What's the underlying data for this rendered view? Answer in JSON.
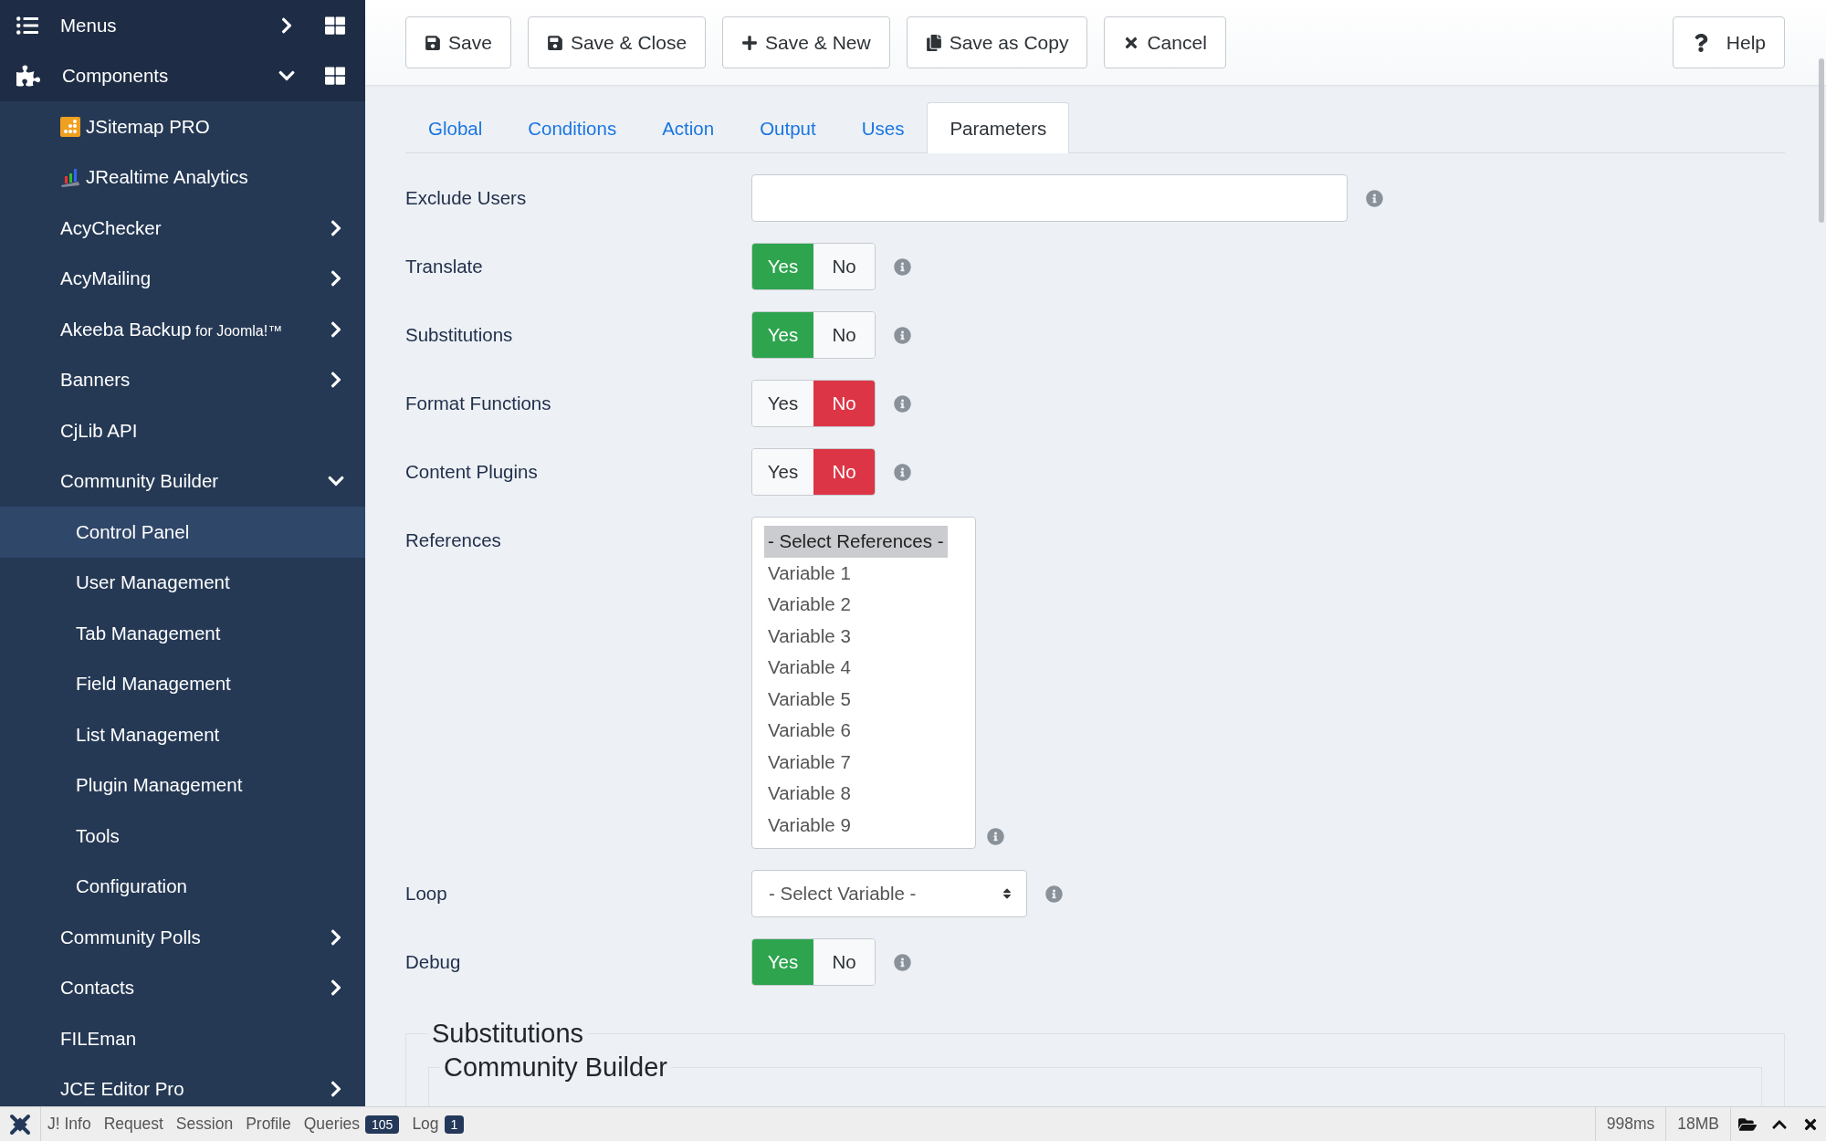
{
  "sidebar": {
    "items": [
      {
        "label": "Menus",
        "expanded": false,
        "selected": false
      },
      {
        "label": "Components",
        "expanded": true,
        "selected": false,
        "children": [
          {
            "label": "JSitemap PRO",
            "selected": false
          },
          {
            "label": "JRealtime Analytics",
            "selected": false
          },
          {
            "label": "AcyChecker",
            "expanded": false,
            "selected": false
          },
          {
            "label": "AcyMailing",
            "expanded": false,
            "selected": false
          },
          {
            "label": "Akeeba Backup",
            "suffix": "for Joomla!™",
            "expanded": false,
            "selected": false
          },
          {
            "label": "Banners",
            "expanded": false,
            "selected": false
          },
          {
            "label": "CjLib API",
            "selected": false
          },
          {
            "label": "Community Builder",
            "expanded": true,
            "selected": false,
            "children": [
              {
                "label": "Control Panel",
                "selected": true
              },
              {
                "label": "User Management",
                "selected": false
              },
              {
                "label": "Tab Management",
                "selected": false
              },
              {
                "label": "Field Management",
                "selected": false
              },
              {
                "label": "List Management",
                "selected": false
              },
              {
                "label": "Plugin Management",
                "selected": false
              },
              {
                "label": "Tools",
                "selected": false
              },
              {
                "label": "Configuration",
                "selected": false
              }
            ]
          },
          {
            "label": "Community Polls",
            "expanded": false,
            "selected": false
          },
          {
            "label": "Contacts",
            "expanded": false,
            "selected": false
          },
          {
            "label": "FILEman",
            "selected": false
          },
          {
            "label": "JCE Editor Pro",
            "expanded": false,
            "selected": false
          }
        ]
      }
    ]
  },
  "toolbar": {
    "buttons": [
      {
        "label": "Save"
      },
      {
        "label": "Save & Close"
      },
      {
        "label": "Save & New"
      },
      {
        "label": "Save as Copy"
      },
      {
        "label": "Cancel"
      }
    ],
    "help": "Help"
  },
  "tabs": [
    {
      "label": "Global",
      "selected": false
    },
    {
      "label": "Conditions",
      "selected": false
    },
    {
      "label": "Action",
      "selected": false
    },
    {
      "label": "Output",
      "selected": false
    },
    {
      "label": "Uses",
      "selected": false
    },
    {
      "label": "Parameters",
      "selected": true
    }
  ],
  "fields": [
    {
      "kind": "text",
      "label": "Exclude Users"
    },
    {
      "kind": "toggle",
      "label": "Translate",
      "options": [
        {
          "label": "Yes",
          "selected": true
        },
        {
          "label": "No",
          "selected": false
        }
      ]
    },
    {
      "kind": "toggle",
      "label": "Substitutions",
      "options": [
        {
          "label": "Yes",
          "selected": true
        },
        {
          "label": "No",
          "selected": false
        }
      ]
    },
    {
      "kind": "toggle",
      "label": "Format Functions",
      "options": [
        {
          "label": "Yes",
          "selected": false
        },
        {
          "label": "No",
          "selected": true
        }
      ]
    },
    {
      "kind": "toggle",
      "label": "Content Plugins",
      "options": [
        {
          "label": "Yes",
          "selected": false
        },
        {
          "label": "No",
          "selected": true
        }
      ]
    },
    {
      "kind": "listbox",
      "label": "References",
      "options": [
        {
          "label": "- Select References -",
          "selected": true
        },
        {
          "label": "Variable 1",
          "selected": false
        },
        {
          "label": "Variable 2",
          "selected": false
        },
        {
          "label": "Variable 3",
          "selected": false
        },
        {
          "label": "Variable 4",
          "selected": false
        },
        {
          "label": "Variable 5",
          "selected": false
        },
        {
          "label": "Variable 6",
          "selected": false
        },
        {
          "label": "Variable 7",
          "selected": false
        },
        {
          "label": "Variable 8",
          "selected": false
        },
        {
          "label": "Variable 9",
          "selected": false
        }
      ]
    },
    {
      "kind": "select",
      "label": "Loop",
      "value": "- Select Variable -"
    },
    {
      "kind": "toggle",
      "label": "Debug",
      "options": [
        {
          "label": "Yes",
          "selected": true
        },
        {
          "label": "No",
          "selected": false
        }
      ]
    }
  ],
  "fieldset": {
    "legend": "Substitutions",
    "inner_legend": "Community Builder"
  },
  "debug_bar": {
    "items": [
      {
        "label": "J! Info"
      },
      {
        "label": "Request"
      },
      {
        "label": "Session"
      },
      {
        "label": "Profile"
      },
      {
        "label": "Queries",
        "badge": "105"
      },
      {
        "label": "Log",
        "badge": "1"
      }
    ],
    "stats": [
      "998ms",
      "18MB"
    ]
  }
}
